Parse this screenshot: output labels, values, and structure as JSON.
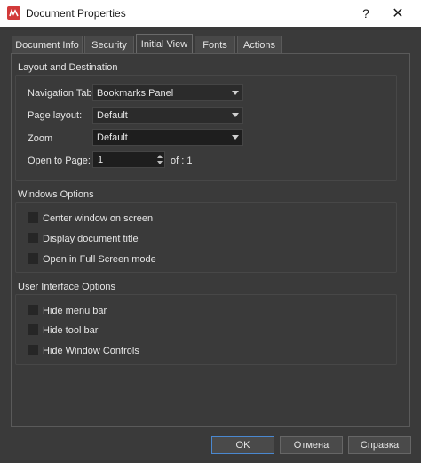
{
  "window": {
    "title": "Document Properties",
    "help": "?",
    "close": "✕"
  },
  "tabs": [
    {
      "label": "Document Info"
    },
    {
      "label": "Security"
    },
    {
      "label": "Initial View",
      "active": true
    },
    {
      "label": "Fonts"
    },
    {
      "label": "Actions"
    }
  ],
  "layout_group": {
    "title": "Layout and Destination",
    "navigation_tab": {
      "label": "Navigation Tab:",
      "value": "Bookmarks Panel"
    },
    "page_layout": {
      "label": "Page layout:",
      "value": "Default"
    },
    "zoom": {
      "label": "Zoom",
      "value": "Default"
    },
    "open_to_page": {
      "label": "Open to Page:",
      "value": "1",
      "of_text": "of : 1"
    }
  },
  "windows_group": {
    "title": "Windows Options",
    "options": [
      {
        "label": "Center window on screen",
        "checked": false
      },
      {
        "label": "Display document title",
        "checked": false
      },
      {
        "label": "Open in Full Screen mode",
        "checked": false
      }
    ]
  },
  "ui_group": {
    "title": "User Interface Options",
    "options": [
      {
        "label": "Hide menu bar",
        "checked": false
      },
      {
        "label": "Hide tool bar",
        "checked": false
      },
      {
        "label": "Hide Window Controls",
        "checked": false
      }
    ]
  },
  "buttons": {
    "ok": "OK",
    "cancel": "Отмена",
    "help": "Справка"
  },
  "colors": {
    "accent": "#4a88d0",
    "app_icon": "#d23a3a"
  }
}
